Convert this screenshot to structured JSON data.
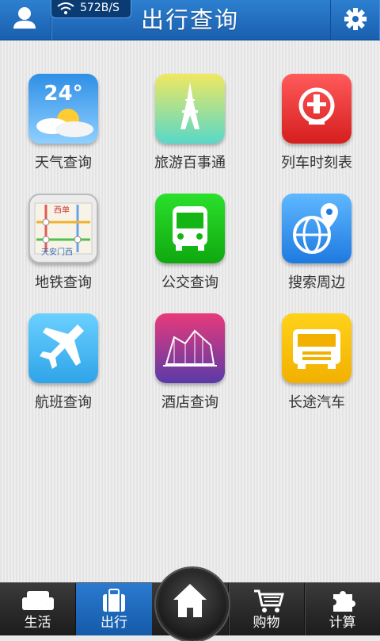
{
  "header": {
    "title": "出行查询",
    "network_speed": "572B/S",
    "left_icon": "user-icon",
    "right_icon": "gear-icon"
  },
  "tiles": [
    {
      "label": "天气查询",
      "icon": "weather-icon",
      "icon_text": "24°"
    },
    {
      "label": "旅游百事通",
      "icon": "eiffel-tower-icon"
    },
    {
      "label": "列车时刻表",
      "icon": "railway-icon"
    },
    {
      "label": "地铁查询",
      "icon": "subway-map-icon",
      "map_text_top": "西单",
      "map_text_bottom": "天安门西"
    },
    {
      "label": "公交查询",
      "icon": "bus-icon"
    },
    {
      "label": "搜索周边",
      "icon": "globe-pin-icon"
    },
    {
      "label": "航班查询",
      "icon": "airplane-icon"
    },
    {
      "label": "酒店查询",
      "icon": "hotel-building-icon"
    },
    {
      "label": "长途汽车",
      "icon": "coach-bus-icon"
    }
  ],
  "nav": {
    "items": [
      {
        "label": "生活",
        "icon": "sofa-icon"
      },
      {
        "label": "出行",
        "icon": "suitcase-icon"
      },
      {
        "label": "",
        "icon": "home-icon"
      },
      {
        "label": "购物",
        "icon": "cart-icon"
      },
      {
        "label": "计算",
        "icon": "puzzle-icon"
      }
    ],
    "active": "出行"
  },
  "colors": {
    "header": "#1f6ab8",
    "nav_bg": "#262626",
    "nav_active": "#1f6ab8"
  }
}
